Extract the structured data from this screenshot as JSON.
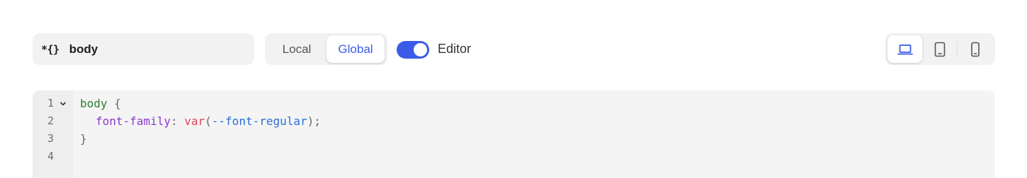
{
  "toolbar": {
    "selector_icon": "*{}",
    "selector_text": "body",
    "scope_options": {
      "local": "Local",
      "global": "Global",
      "selected": "Global"
    },
    "editor_toggle": {
      "label": "Editor",
      "on": true
    },
    "devices": [
      {
        "icon": "laptop-icon",
        "active": true
      },
      {
        "icon": "tablet-icon",
        "active": false
      },
      {
        "icon": "mobile-icon",
        "active": false
      }
    ],
    "accent_color": "#3b5be8"
  },
  "editor": {
    "line_numbers": [
      "1",
      "2",
      "3",
      "4"
    ],
    "line1": {
      "selector": "body",
      "brace_open": " {"
    },
    "line2": {
      "property": "font-family",
      "colon": ": ",
      "fn": "var",
      "paren_open": "(",
      "variable": "--font-regular",
      "paren_close": ");"
    },
    "line3": {
      "brace_close": "}"
    },
    "line4": ""
  }
}
